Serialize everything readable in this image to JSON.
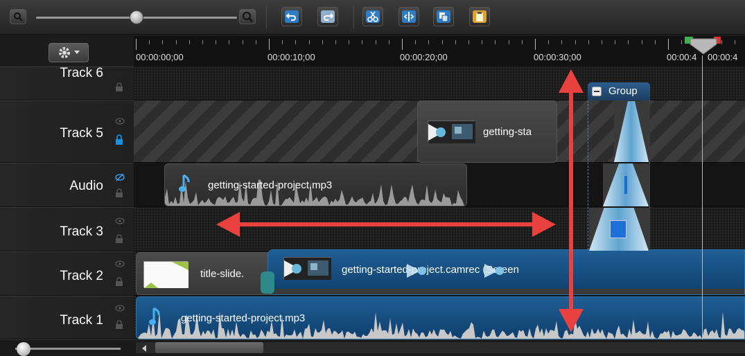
{
  "toolbar": {
    "buttons": [
      "zoom-out",
      "zoom-in",
      "undo",
      "redo",
      "cut",
      "split",
      "copy",
      "paste"
    ]
  },
  "ruler": {
    "labels": [
      "00:00:00;00",
      "00:00:10;00",
      "00:00:20;00",
      "00:00:30;00",
      "00:00:4",
      "00:00:4"
    ]
  },
  "tracks": [
    {
      "name": "Track 6"
    },
    {
      "name": "Track 5"
    },
    {
      "name": "Audio"
    },
    {
      "name": "Track 3"
    },
    {
      "name": "Track 2"
    },
    {
      "name": "Track 1"
    }
  ],
  "clips": {
    "track5": "getting-sta",
    "audio": "getting-started-project.mp3",
    "track2_title": "title-slide.",
    "track2_rec": "getting-started-project.camrec (Screen",
    "track1": "getting-started-project.mp3"
  },
  "group": {
    "label": "Group"
  },
  "colors": {
    "arrow": "#e8413f",
    "clip_blue": "#1f5e94",
    "clip_gray": "#444444",
    "transition": "#5fa3cf"
  }
}
